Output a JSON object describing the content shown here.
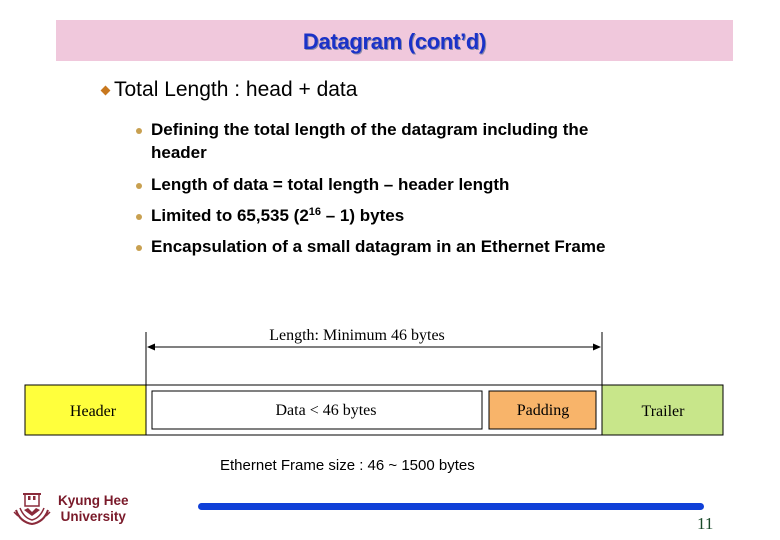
{
  "slide": {
    "title": "Datagram (cont’d)",
    "main_bullet": "Total Length : head + data",
    "sub_bullets": [
      {
        "line1": "Defining the total length of the datagram including the",
        "line2": "header"
      },
      {
        "text": "Length of data = total length – header length"
      },
      {
        "pre": "Limited to 65,535 (2",
        "sup": "16",
        "post": " – 1) bytes"
      },
      {
        "text": "Encapsulation of a small datagram in an Ethernet Frame"
      }
    ],
    "colors": {
      "title_bg": "#f0c8dc",
      "title_text": "#1a32c8",
      "header_box": "#ffff3c",
      "padding_box": "#f8b46a",
      "trailer_box": "#c8e68a",
      "footer_bar": "#1040d8"
    }
  },
  "diagram": {
    "length_label": "Length: Minimum 46 bytes",
    "boxes": {
      "header": "Header",
      "data": "Data <  46 bytes",
      "padding": "Padding",
      "trailer": "Trailer"
    },
    "caption": "Ethernet Frame size : 46 ~ 1500 bytes"
  },
  "footer": {
    "logo_line1": "Kyung Hee",
    "logo_line2": "University",
    "logo_icon": "university-emblem-icon",
    "page_number": "11"
  }
}
